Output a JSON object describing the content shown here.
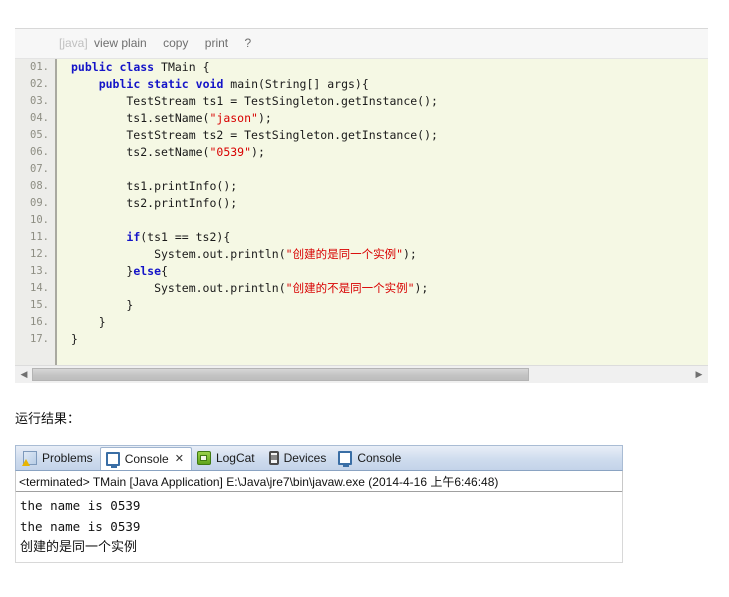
{
  "code_block": {
    "toolbar": {
      "lang": "[java]",
      "view_plain": "view plain",
      "copy": "copy",
      "print": "print",
      "help": "?"
    },
    "line_numbers": [
      "01.",
      "02.",
      "03.",
      "04.",
      "05.",
      "06.",
      "07.",
      "08.",
      "09.",
      "10.",
      "11.",
      "12.",
      "13.",
      "14.",
      "15.",
      "16.",
      "17."
    ],
    "lines": [
      "public class TMain {",
      "    public static void main(String[] args){",
      "        TestStream ts1 = TestSingleton.getInstance();",
      "        ts1.setName(\"jason\");",
      "        TestStream ts2 = TestSingleton.getInstance();",
      "        ts2.setName(\"0539\");",
      "",
      "        ts1.printInfo();",
      "        ts2.printInfo();",
      "",
      "        if(ts1 == ts2){",
      "            System.out.println(\"创建的是同一个实例\");",
      "        }else{",
      "            System.out.println(\"创建的不是同一个实例\");",
      "        }",
      "    }",
      "}"
    ],
    "scrollbar": {
      "left_arrow": "◀",
      "right_arrow": "▶"
    },
    "colors": {
      "background": "#f5f8e4",
      "gutter": "#ededea",
      "keyword": "#1414c8",
      "string": "#d80000"
    }
  },
  "result_label": "运行结果：",
  "console": {
    "tabs": [
      {
        "label": "Problems",
        "icon": "problems-icon",
        "active": false,
        "close": ""
      },
      {
        "label": "Console",
        "icon": "console-icon",
        "active": true,
        "close": "✕"
      },
      {
        "label": "LogCat",
        "icon": "logcat-icon",
        "active": false,
        "close": ""
      },
      {
        "label": "Devices",
        "icon": "devices-icon",
        "active": false,
        "close": ""
      },
      {
        "label": "Console",
        "icon": "console-icon",
        "active": false,
        "close": ""
      }
    ],
    "header": "<terminated> TMain [Java Application] E:\\Java\\jre7\\bin\\javaw.exe (2014-4-16 上午6:46:48)",
    "output": [
      "the name is 0539",
      "the name is 0539",
      "创建的是同一个实例"
    ]
  }
}
